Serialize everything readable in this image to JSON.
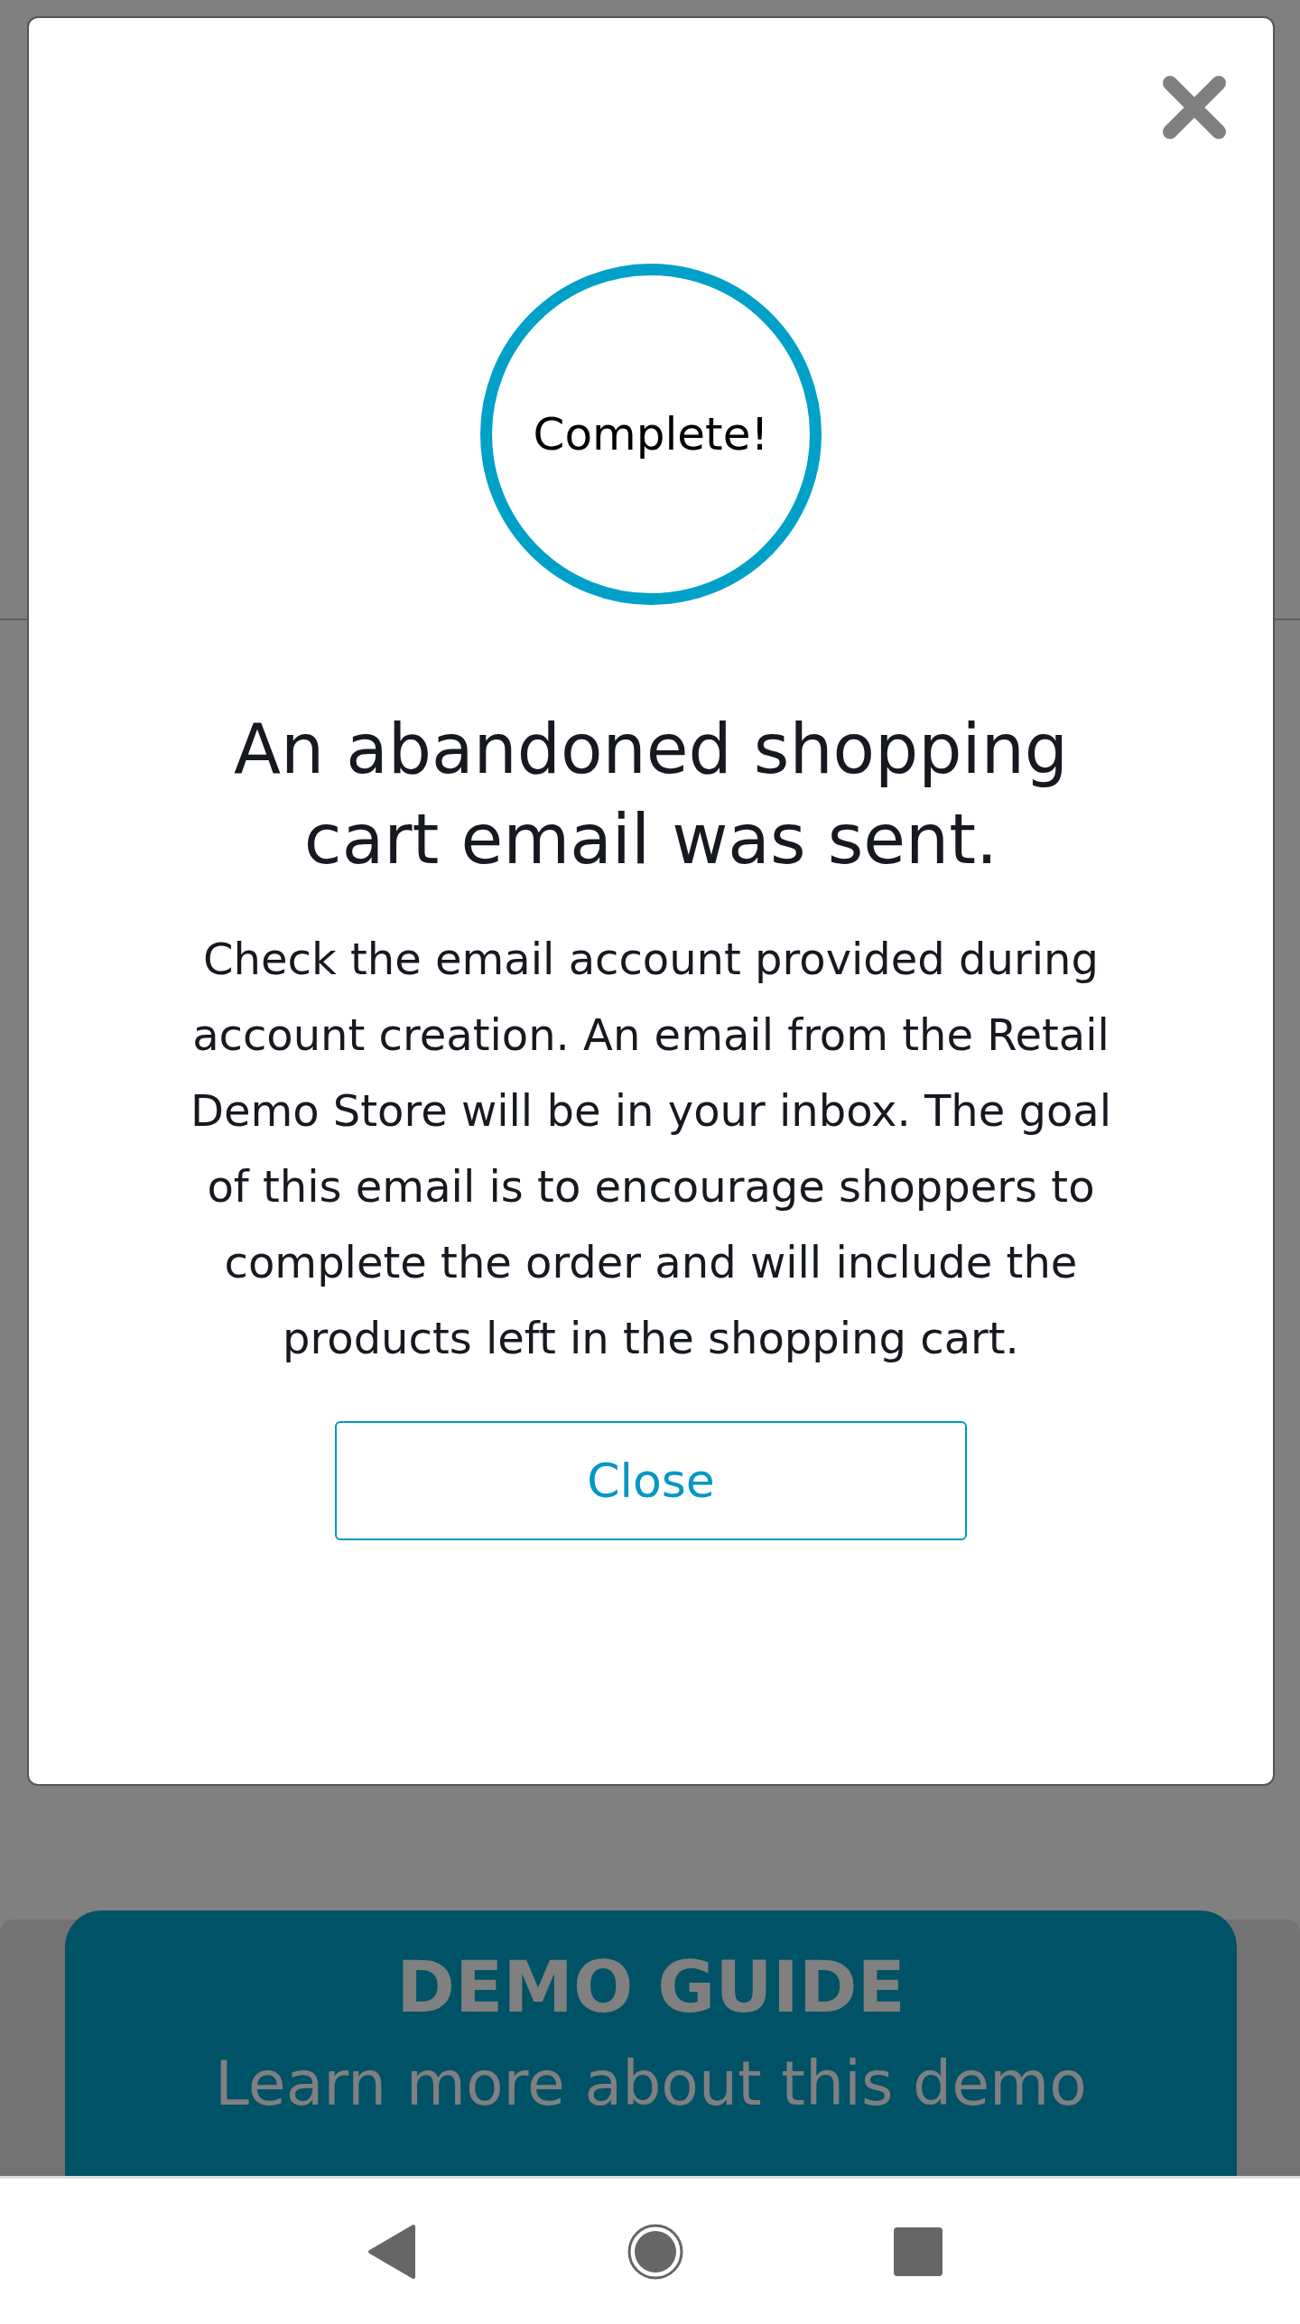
{
  "modal": {
    "badge": "Complete!",
    "title": "An abandoned shopping cart email was sent.",
    "message": "Check the email account provided during account creation. An email from the Retail Demo Store will be in your inbox. The goal of this email is to encourage shoppers to complete the order and will include the products left in the shopping cart.",
    "button": "Close"
  },
  "demo_guide": {
    "title": "DEMO GUIDE",
    "subtitle": "Learn more about this demo"
  }
}
